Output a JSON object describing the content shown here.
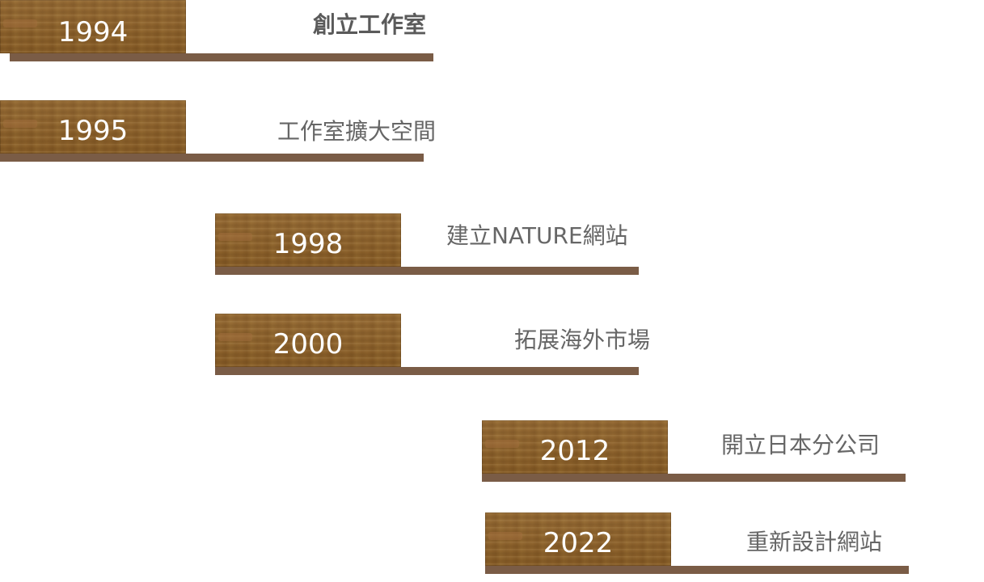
{
  "timeline": [
    {
      "year": "1994",
      "event": "創立工作室"
    },
    {
      "year": "1995",
      "event": "工作室擴大空間"
    },
    {
      "year": "1998",
      "event": "建立NATURE網站"
    },
    {
      "year": "2000",
      "event": "拓展海外市場"
    },
    {
      "year": "2012",
      "event": "開立日本分公司"
    },
    {
      "year": "2022",
      "event": "重新設計網站"
    }
  ],
  "colors": {
    "wood": "#8b5f28",
    "bar": "#7a5c46",
    "year_text": "#ffffff",
    "event_text": "#666666"
  }
}
